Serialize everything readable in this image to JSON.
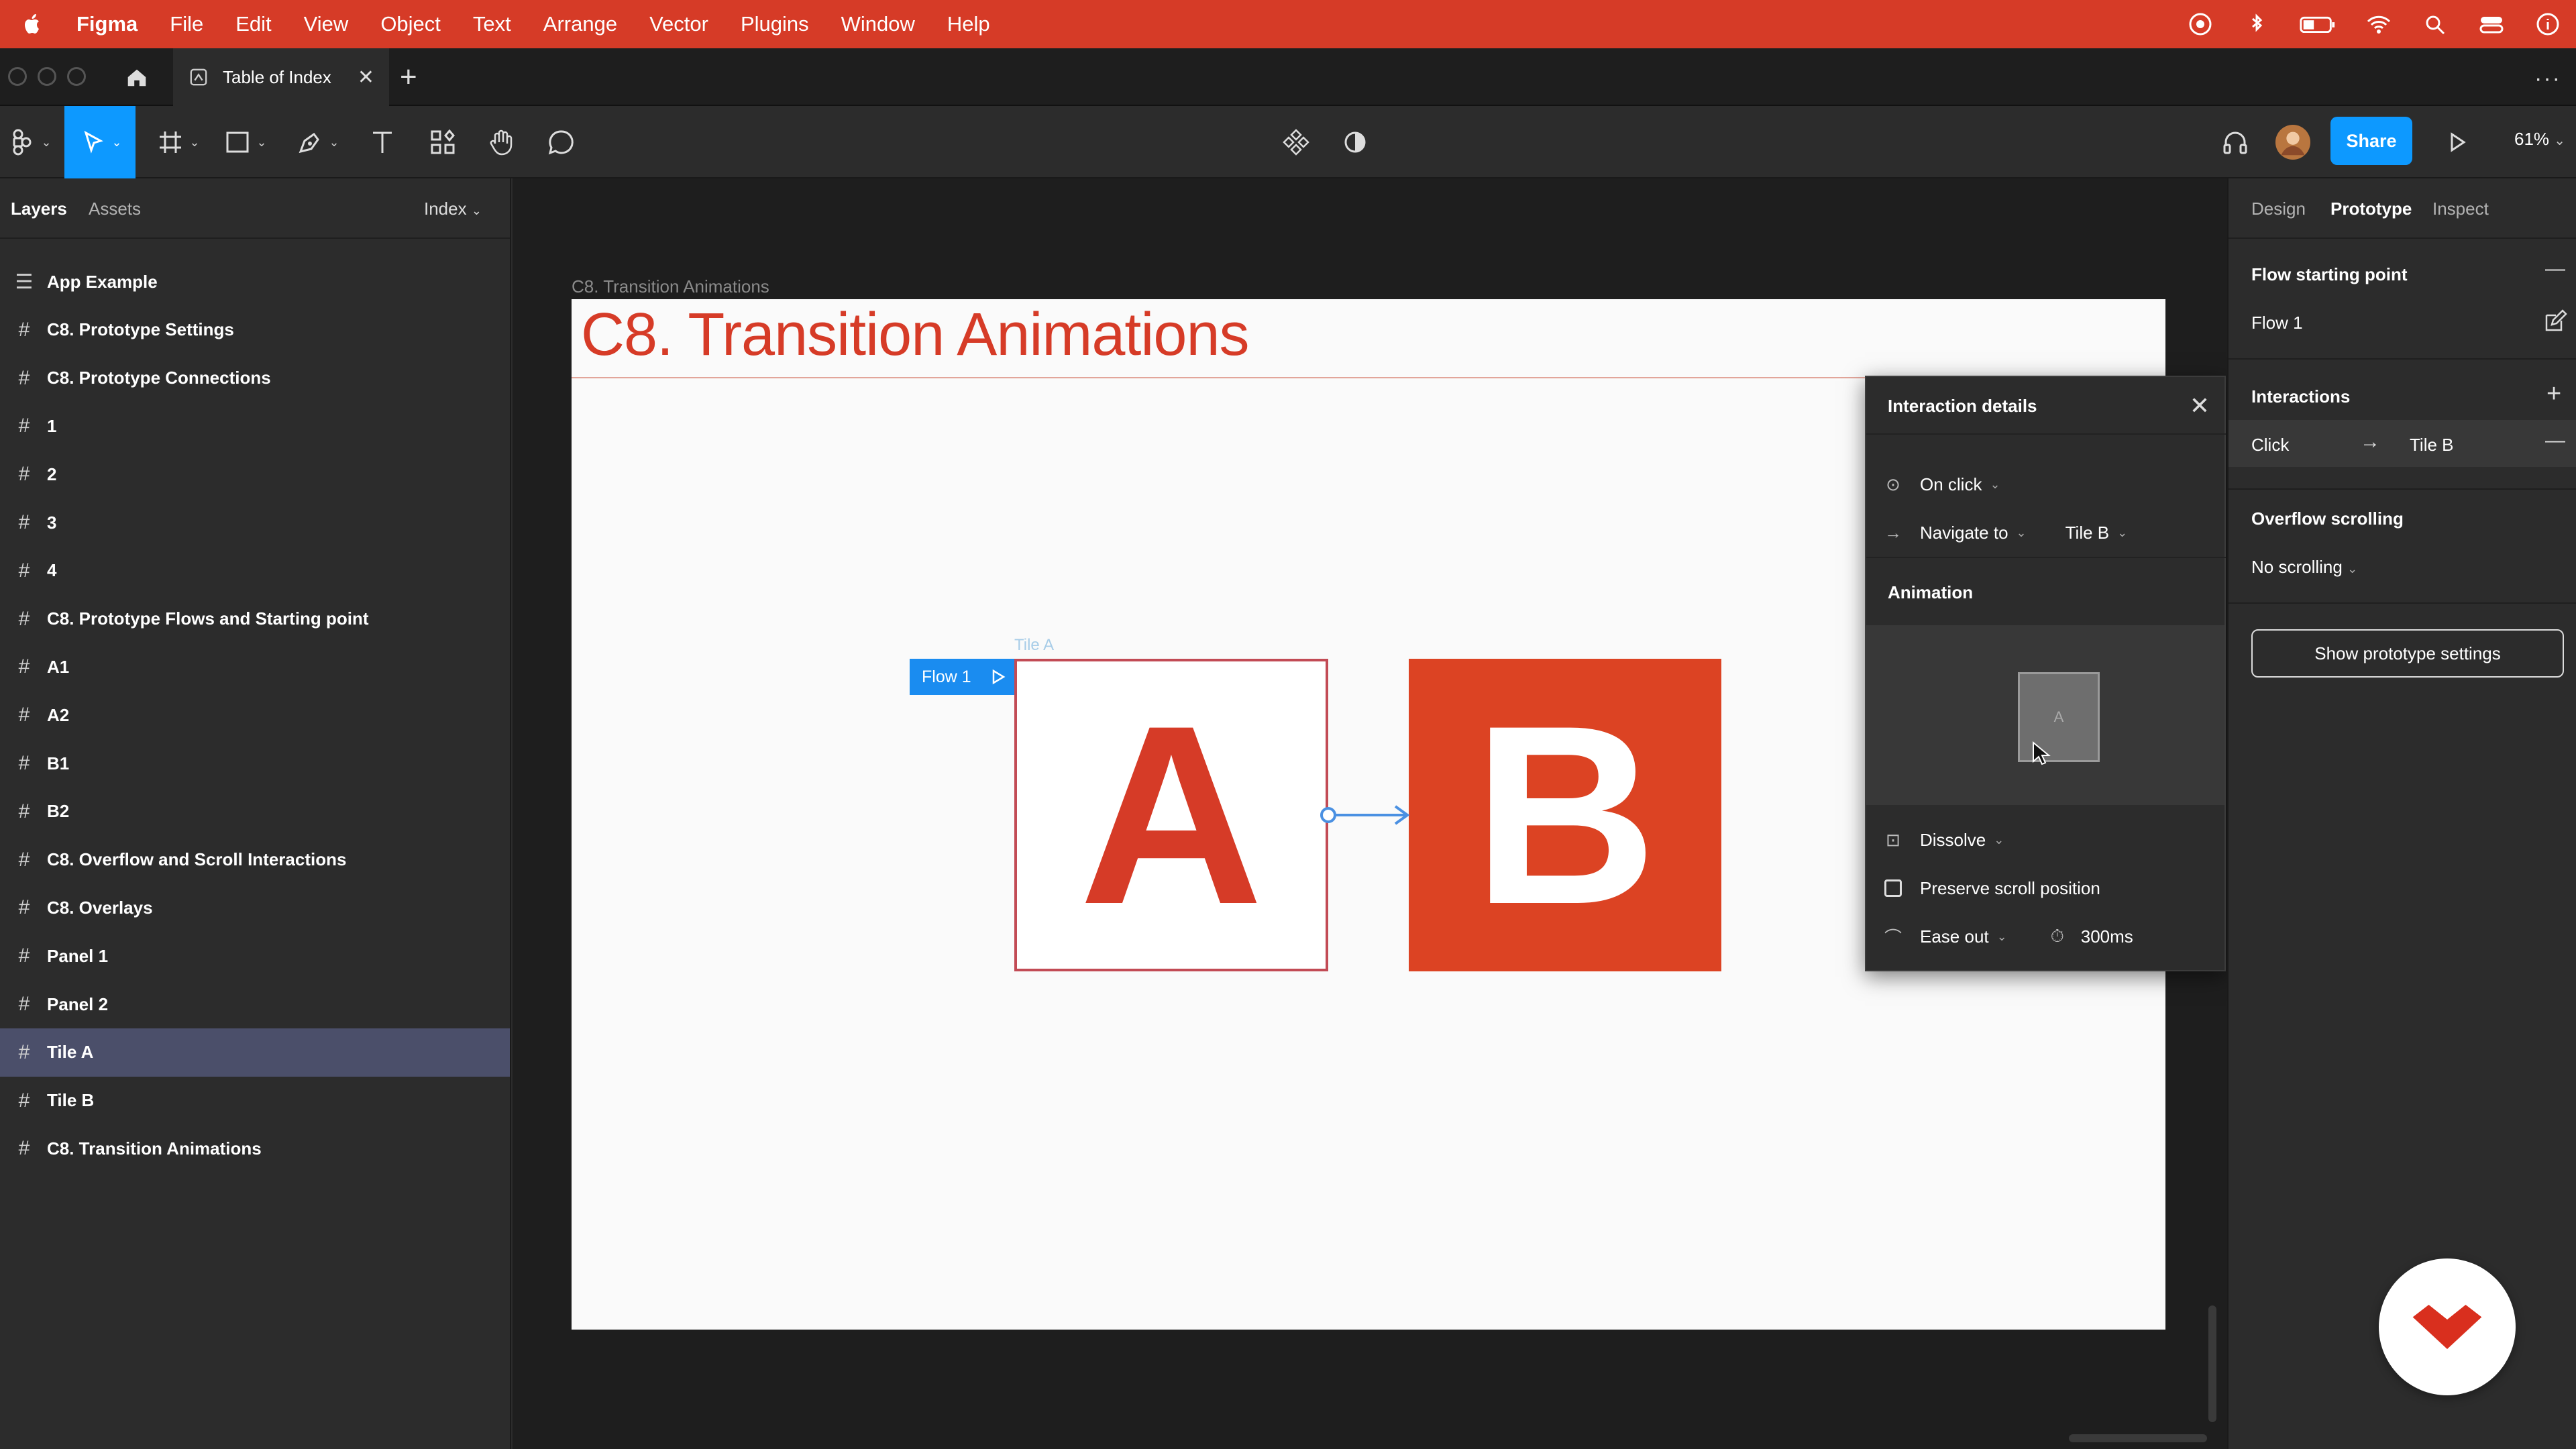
{
  "menubar": {
    "app_name": "Figma",
    "items": [
      "File",
      "Edit",
      "View",
      "Object",
      "Text",
      "Arrange",
      "Vector",
      "Plugins",
      "Window",
      "Help"
    ]
  },
  "tabs": {
    "document_title": "Table of Index"
  },
  "toolbar": {
    "share_label": "Share",
    "zoom": "61%"
  },
  "left_panel": {
    "tab_layers": "Layers",
    "tab_assets": "Assets",
    "page_selector": "Index",
    "layers": [
      {
        "name": "App Example",
        "type": "section"
      },
      {
        "name": "C8. Prototype Settings",
        "type": "frame"
      },
      {
        "name": "C8. Prototype Connections",
        "type": "frame"
      },
      {
        "name": "1",
        "type": "frame"
      },
      {
        "name": "2",
        "type": "frame"
      },
      {
        "name": "3",
        "type": "frame"
      },
      {
        "name": "4",
        "type": "frame"
      },
      {
        "name": "C8. Prototype Flows and Starting point",
        "type": "frame"
      },
      {
        "name": "A1",
        "type": "frame"
      },
      {
        "name": "A2",
        "type": "frame"
      },
      {
        "name": "B1",
        "type": "frame"
      },
      {
        "name": "B2",
        "type": "frame"
      },
      {
        "name": "C8. Overflow and Scroll Interactions",
        "type": "frame"
      },
      {
        "name": "C8. Overlays",
        "type": "frame"
      },
      {
        "name": "Panel 1",
        "type": "frame"
      },
      {
        "name": "Panel 2",
        "type": "frame"
      },
      {
        "name": "Tile A",
        "type": "frame",
        "selected": true
      },
      {
        "name": "Tile B",
        "type": "frame"
      },
      {
        "name": "C8. Transition Animations",
        "type": "frame"
      }
    ]
  },
  "canvas": {
    "frame_label": "C8. Transition Animations",
    "frame_heading": "C8.  Transition Animations",
    "tile_a_label": "Tile A",
    "tile_a_letter": "A",
    "tile_b_letter": "B",
    "flow_badge": "Flow 1",
    "accent_color": "#d63b27",
    "selection_color": "#1a8cf0"
  },
  "interaction_popup": {
    "title": "Interaction details",
    "trigger": "On click",
    "action": "Navigate to",
    "destination": "Tile B",
    "animation_heading": "Animation",
    "preview_letter": "A",
    "animation_type": "Dissolve",
    "preserve_scroll_label": "Preserve scroll position",
    "preserve_scroll_checked": false,
    "easing": "Ease out",
    "duration": "300ms"
  },
  "right_panel": {
    "tab_design": "Design",
    "tab_prototype": "Prototype",
    "tab_inspect": "Inspect",
    "flow_heading": "Flow starting point",
    "flow_name": "Flow 1",
    "interactions_heading": "Interactions",
    "interaction_trigger": "Click",
    "interaction_target": "Tile B",
    "overflow_heading": "Overflow scrolling",
    "overflow_value": "No scrolling",
    "show_settings_label": "Show prototype settings"
  }
}
